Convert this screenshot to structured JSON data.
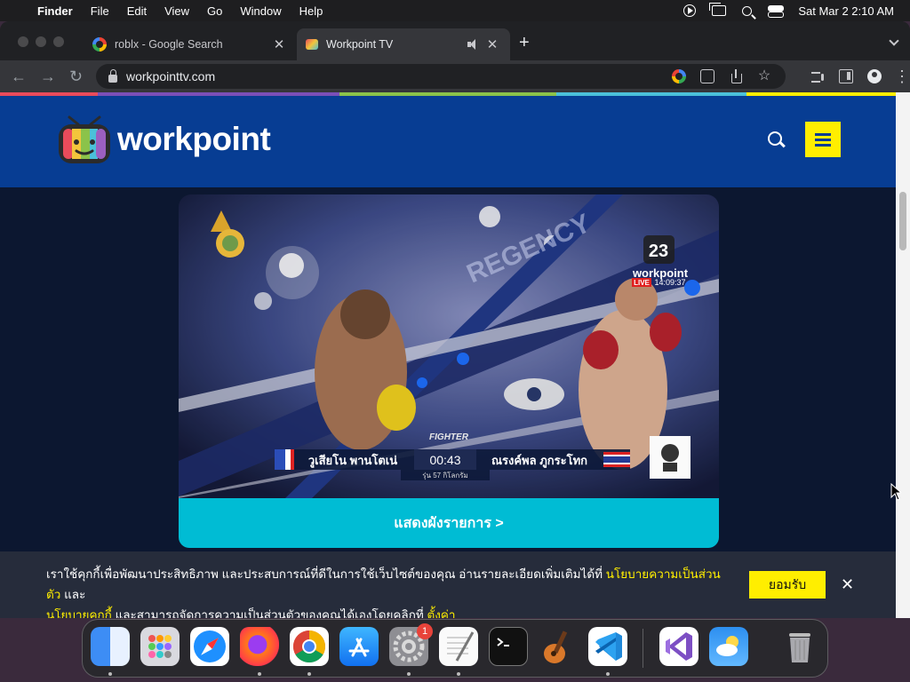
{
  "menubar": {
    "app_name": "Finder",
    "menus": [
      "File",
      "Edit",
      "View",
      "Go",
      "Window",
      "Help"
    ],
    "clock": "Sat Mar 2  2:10 AM",
    "status_icons": [
      "play-circle-icon",
      "screen-mirroring-icon",
      "spotlight-search-icon",
      "control-center-icon"
    ]
  },
  "browser": {
    "tabs": [
      {
        "title": "roblx - Google Search",
        "favicon": "google-icon",
        "active": false
      },
      {
        "title": "Workpoint TV",
        "favicon": "workpoint-icon",
        "active": true,
        "audio_playing": true
      }
    ],
    "url": "workpointtv.com",
    "toolbar_icons": [
      "google-lens-icon",
      "translate-icon",
      "share-icon",
      "bookmark-star-icon",
      "media-control-icon",
      "side-panel-icon",
      "profile-icon",
      "menu-icon"
    ],
    "strip_colors": [
      "#e94b5b",
      "#7b4fb8",
      "#8bc34a",
      "#4bc0d9",
      "#ffee00"
    ]
  },
  "site": {
    "logo_text": "workpoint",
    "accent": "#ffee00",
    "header_bg": "#073d93"
  },
  "player": {
    "channel_number": "23",
    "channel_name": "workpoint",
    "live_label": "LIVE",
    "live_time": "14:09:37",
    "fighter_left": "วูเสียโน พานโตเน่",
    "fighter_right": "ณรงค์พล ภูกระโทก",
    "timer": "00:43",
    "weight_class": "รุ่น 57 กิโลกรัม",
    "event_logo": "FIGHTER",
    "ring_text": "REGENCY"
  },
  "schedule_button": "แสดงผังรายการ >",
  "cookie_banner": {
    "text_1": "เราใช้คุกกี้เพื่อพัฒนาประสิทธิภาพ และประสบการณ์ที่ดีในการใช้เว็บไซต์ของคุณ อ่านรายละเอียดเพิ่มเติมได้ที่ ",
    "link_privacy": "นโยบายความเป็นส่วนตัว",
    "text_2": " และ",
    "link_cookie": "นโยบายคุกกี้",
    "text_3": " และสามารถจัดการความเป็นส่วนตัวของคุณได้เองโดยคลิกที่ ",
    "link_settings": "ตั้งค่า",
    "accept": "ยอมรับ",
    "close": "✕"
  },
  "dock": {
    "items": [
      "finder",
      "launchpad",
      "safari",
      "firefox",
      "chrome",
      "app-store",
      "system-settings",
      "textedit",
      "terminal",
      "garageband",
      "vscode",
      "visual-studio",
      "weather",
      "trash"
    ],
    "system_settings_badge": "1"
  }
}
